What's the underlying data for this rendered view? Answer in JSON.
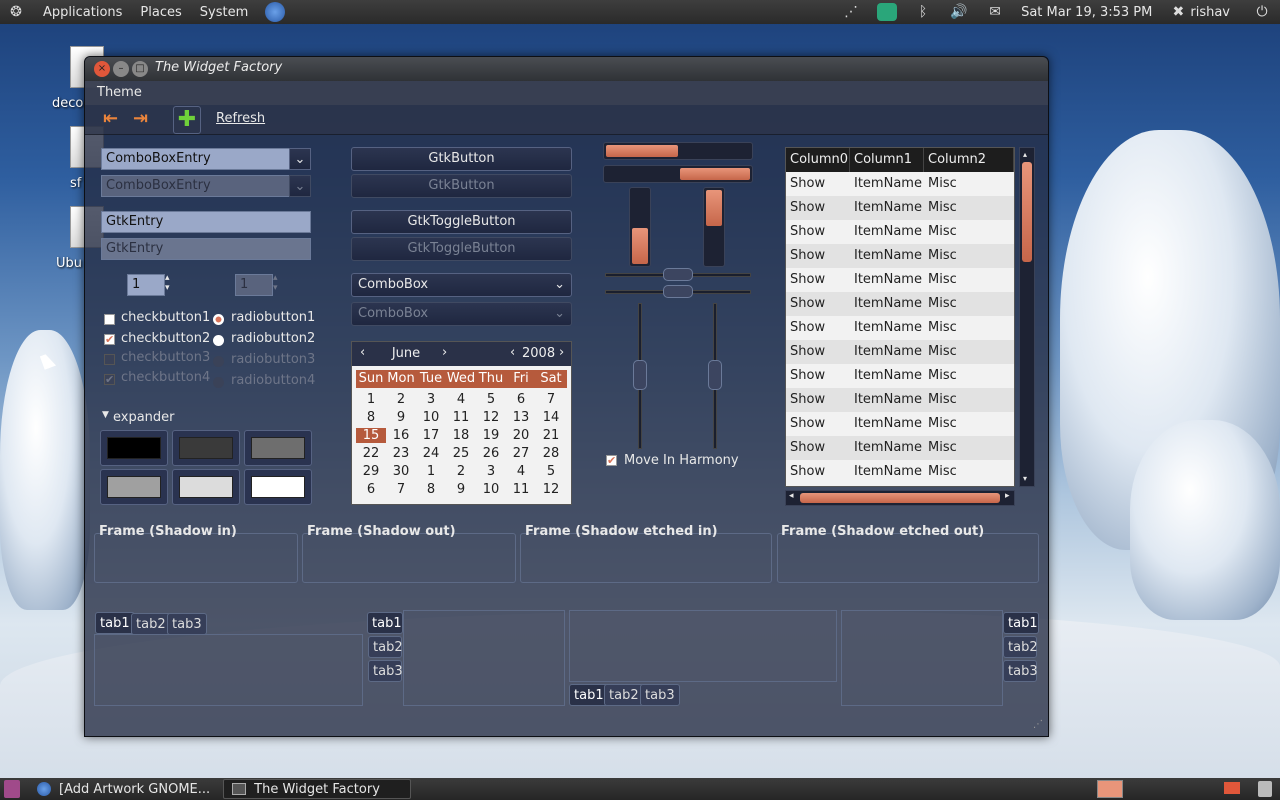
{
  "top_panel": {
    "menus": [
      "Applications",
      "Places",
      "System"
    ],
    "clock": "Sat Mar 19,  3:53 PM",
    "user": "rishav"
  },
  "desktop": {
    "icons": [
      {
        "label": "deco"
      },
      {
        "label": "sf"
      },
      {
        "label": "Ubu"
      }
    ]
  },
  "window": {
    "title": "The Widget Factory",
    "menu": "Theme",
    "toolbar": {
      "refresh": "Refresh"
    },
    "combo_entries": [
      "ComboBoxEntry",
      "ComboBoxEntry"
    ],
    "entries": [
      "GtkEntry",
      "GtkEntry"
    ],
    "spin_values": [
      "1",
      "1"
    ],
    "checkbuttons": [
      "checkbutton1",
      "checkbutton2",
      "checkbutton3",
      "checkbutton4"
    ],
    "radiobuttons": [
      "radiobutton1",
      "radiobutton2",
      "radiobutton3",
      "radiobutton4"
    ],
    "expander": "expander",
    "buttons": [
      "GtkButton",
      "GtkButton"
    ],
    "toggle_buttons": [
      "GtkToggleButton",
      "GtkToggleButton"
    ],
    "comboboxes": [
      "ComboBox",
      "ComboBox"
    ],
    "calendar": {
      "month": "June",
      "year": "2008",
      "weekdays": [
        "Sun",
        "Mon",
        "Tue",
        "Wed",
        "Thu",
        "Fri",
        "Sat"
      ],
      "selected_day": "15",
      "rows": [
        [
          "1",
          "2",
          "3",
          "4",
          "5",
          "6",
          "7"
        ],
        [
          "8",
          "9",
          "10",
          "11",
          "12",
          "13",
          "14"
        ],
        [
          "15",
          "16",
          "17",
          "18",
          "19",
          "20",
          "21"
        ],
        [
          "22",
          "23",
          "24",
          "25",
          "26",
          "27",
          "28"
        ],
        [
          "29",
          "30",
          "1",
          "2",
          "3",
          "4",
          "5"
        ],
        [
          "6",
          "7",
          "8",
          "9",
          "10",
          "11",
          "12"
        ]
      ]
    },
    "progress": {
      "horizontal_1": 0.5,
      "horizontal_2": 0.5,
      "vertical_1": 0.5,
      "vertical_2": 0.5
    },
    "move_in_harmony": "Move In Harmony",
    "tree_view": {
      "columns": [
        "Column0",
        "Column1",
        "Column2"
      ],
      "rows": [
        [
          "Show",
          "ItemName",
          "Misc"
        ],
        [
          "Show",
          "ItemName",
          "Misc"
        ],
        [
          "Show",
          "ItemName",
          "Misc"
        ],
        [
          "Show",
          "ItemName",
          "Misc"
        ],
        [
          "Show",
          "ItemName",
          "Misc"
        ],
        [
          "Show",
          "ItemName",
          "Misc"
        ],
        [
          "Show",
          "ItemName",
          "Misc"
        ],
        [
          "Show",
          "ItemName",
          "Misc"
        ],
        [
          "Show",
          "ItemName",
          "Misc"
        ],
        [
          "Show",
          "ItemName",
          "Misc"
        ],
        [
          "Show",
          "ItemName",
          "Misc"
        ],
        [
          "Show",
          "ItemName",
          "Misc"
        ],
        [
          "Show",
          "ItemName",
          "Misc"
        ]
      ]
    },
    "frames": [
      "Frame (Shadow in)",
      "Frame (Shadow out)",
      "Frame (Shadow etched in)",
      "Frame (Shadow etched out)"
    ],
    "tabs": [
      "tab1",
      "tab2",
      "tab3"
    ]
  },
  "taskbar": {
    "tasks": [
      "[Add Artwork GNOME...",
      "The Widget Factory"
    ]
  },
  "colors": {
    "accent": "#d9745a",
    "panel": "#2f2f2f"
  }
}
